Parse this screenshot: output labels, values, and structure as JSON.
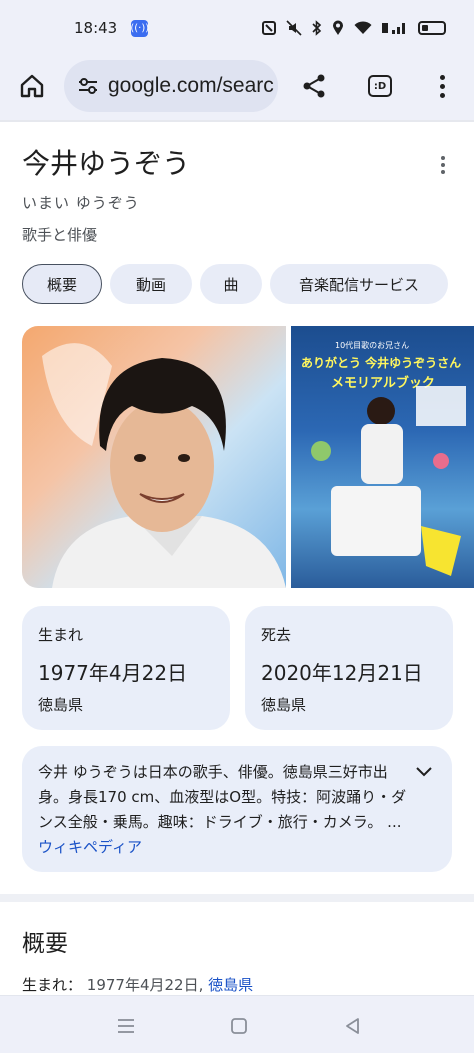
{
  "status_bar": {
    "time": "18:43",
    "icons": [
      "cast-icon",
      "nfc-icon",
      "mute-icon",
      "bluetooth-icon",
      "location-icon",
      "wifi-icon",
      "signal-icon",
      "battery-icon"
    ]
  },
  "browser": {
    "url": "google.com/searc",
    "icons": [
      "home-icon",
      "site-settings-icon",
      "share-icon",
      "tab-switcher-icon",
      "more-vert-icon"
    ],
    "tab_switcher_label": ":D"
  },
  "knowledge_panel": {
    "title": "今井ゆうぞう",
    "reading": "いまい ゆうぞう",
    "subtitle": "歌手と俳優",
    "chips": [
      {
        "label": "概要",
        "active": true
      },
      {
        "label": "動画",
        "active": false
      },
      {
        "label": "曲",
        "active": false
      },
      {
        "label": "音楽配信サービス",
        "active": false
      }
    ],
    "book_cover": {
      "line1": "10代目歌のお兄さん",
      "line2": "ありがとう 今井ゆうぞうさん",
      "line3": "メモリアルブック"
    },
    "facts": [
      {
        "label": "生まれ",
        "value": "1977年4月22日",
        "place": "徳島県"
      },
      {
        "label": "死去",
        "value": "2020年12月21日",
        "place": "徳島県"
      }
    ],
    "description": {
      "text": "今井 ゆうぞうは日本の歌手、俳優。徳島県三好市出身。身長170 cm、血液型はO型。特技：阿波踊り・ダンス全般・乗馬。趣味：ドライブ・旅行・カメラ。 ... ",
      "source_link": "ウィキペディア"
    }
  },
  "about_section": {
    "title": "概要",
    "born_label": "生まれ：",
    "born_value": "1977年4月22日,",
    "born_place_link": "徳島県"
  },
  "nav_bar": {
    "icons": [
      "recents-icon",
      "home-nav-icon",
      "back-icon"
    ]
  },
  "colors": {
    "chrome_bg": "#eef0f9",
    "card_bg": "#e9eef9",
    "link": "#1a52c7"
  }
}
